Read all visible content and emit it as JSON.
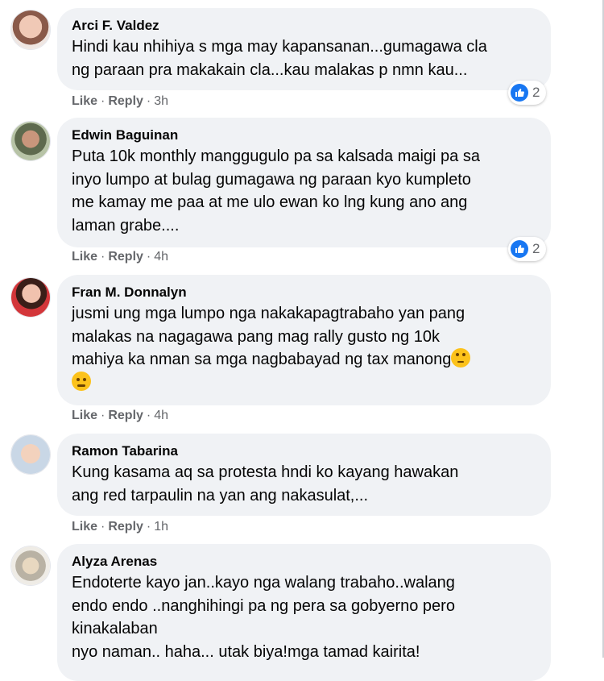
{
  "comments": [
    {
      "author": "Arci F. Valdez",
      "lines": [
        "Hindi kau nhihiya s mga may kapansanan...gumagawa cla",
        "ng paraan pra makakain cla...kau malakas p nmn kau..."
      ],
      "like_label": "Like",
      "reply_label": "Reply",
      "time": "3h",
      "reaction_icon": "like-icon",
      "reaction_count": "2"
    },
    {
      "author": "Edwin Baguinan",
      "lines": [
        "Puta 10k monthly manggugulo pa sa kalsada maigi pa sa",
        "inyo lumpo at bulag gumagawa ng paraan kyo kumpleto",
        "me kamay me paa at me ulo ewan ko lng kung ano ang",
        "laman grabe...."
      ],
      "like_label": "Like",
      "reply_label": "Reply",
      "time": "4h",
      "reaction_icon": "like-icon",
      "reaction_count": "2"
    },
    {
      "author": "Fran M. Donnalyn",
      "lines": [
        "jusmi ung mga lumpo nga nakakapagtrabaho yan pang",
        "malakas na nagagawa pang mag rally gusto ng 10k",
        "mahiya ka nman sa mga nagbabayad ng tax manong"
      ],
      "emoji_inline": "eye-roll-emoji",
      "emoji_line": "worried-face-emoji",
      "like_label": "Like",
      "reply_label": "Reply",
      "time": "4h"
    },
    {
      "author": "Ramon Tabarina",
      "lines": [
        "Kung kasama aq sa protesta hndi ko kayang hawakan",
        "ang red tarpaulin na yan ang nakasulat,..."
      ],
      "like_label": "Like",
      "reply_label": "Reply",
      "time": "1h"
    },
    {
      "author": "Alyza Arenas",
      "lines": [
        "Endoterte kayo jan..kayo nga walang trabaho..walang",
        "endo endo ..nanghihingi pa ng pera sa gobyerno pero",
        "kinakalaban",
        "nyo naman.. haha... utak biya!mga tamad kairita!"
      ]
    }
  ],
  "colors": {
    "bubble": "#f0f2f5",
    "like_blue": "#1877f2",
    "meta_gray": "#65676b"
  }
}
